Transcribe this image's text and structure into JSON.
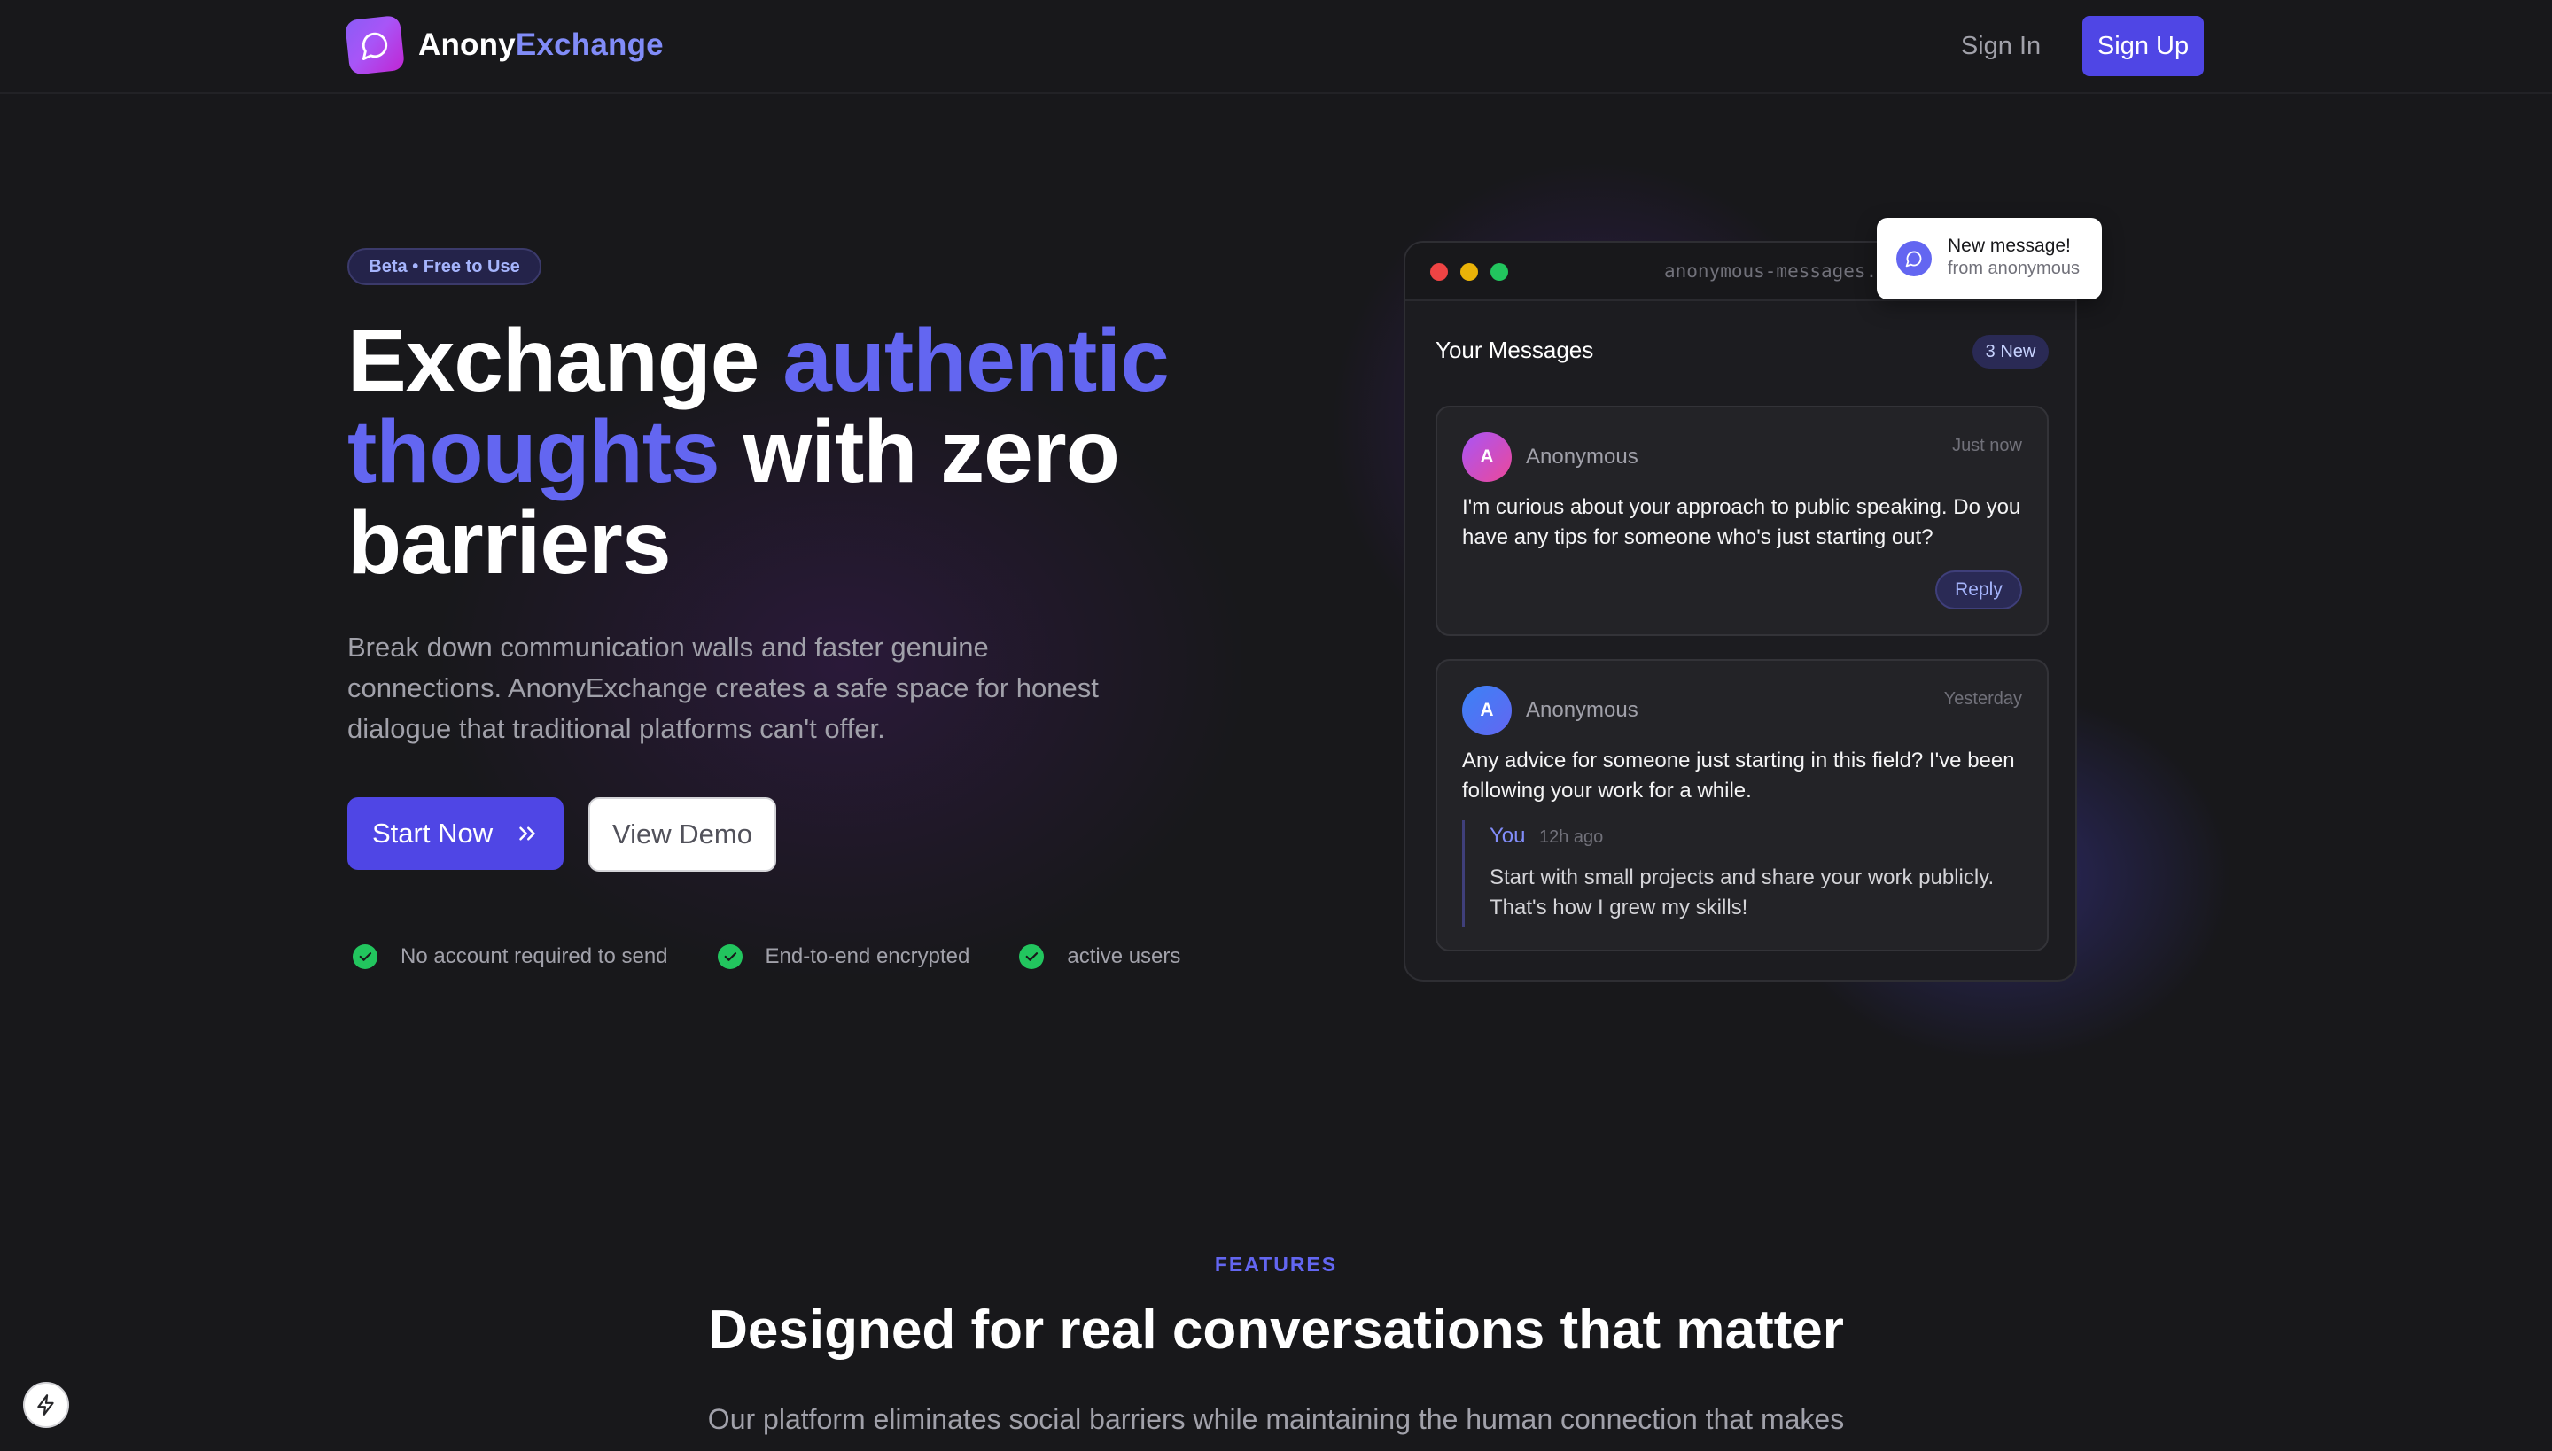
{
  "nav": {
    "logo_part1": "Anony",
    "logo_part2": "Exchange",
    "signin_label": "Sign In",
    "signup_label": "Sign Up"
  },
  "hero": {
    "badge": "Beta • Free to Use",
    "headline_1": "Exchange ",
    "headline_highlight": "authentic thoughts",
    "headline_2": " with zero barriers",
    "subtext": "Break down communication walls and faster genuine connections. AnonyExchange creates a safe space for honest dialogue that traditional platforms can't offer.",
    "start_label": "Start Now",
    "demo_label": "View Demo",
    "checks": [
      "No account required to send",
      "End-to-end encrypted",
      "active users"
    ]
  },
  "mock": {
    "url": "anonymous-messages.app",
    "title": "Your Messages",
    "new_badge": "3 New",
    "messages": [
      {
        "initial": "A",
        "sender": "Anonymous",
        "time": "Just now",
        "body": "I'm curious about your approach to public speaking. Do you have any tips for someone who's just starting out?",
        "reply_label": "Reply"
      },
      {
        "initial": "A",
        "sender": "Anonymous",
        "time": "Yesterday",
        "body": "Any advice for someone just starting in this field? I've been following your work for a while.",
        "reply_author": "You",
        "reply_time": "12h ago",
        "reply_body": "Start with small projects and share your work publicly. That's how I grew my skills!"
      }
    ],
    "notification": {
      "title": "New message!",
      "subtitle": "from anonymous"
    }
  },
  "features": {
    "label": "FEATURES",
    "title": "Designed for real conversations that matter",
    "subtitle": "Our platform eliminates social barriers while maintaining the human connection that makes"
  },
  "colors": {
    "accent": "#4f46e5",
    "highlight": "#6366f1",
    "background": "#18181b",
    "success": "#22c55e"
  },
  "icons": {
    "logo": "chat-bubble-icon",
    "check": "check-circle-icon",
    "chevrons": "chevrons-right-icon",
    "bolt": "bolt-icon"
  }
}
